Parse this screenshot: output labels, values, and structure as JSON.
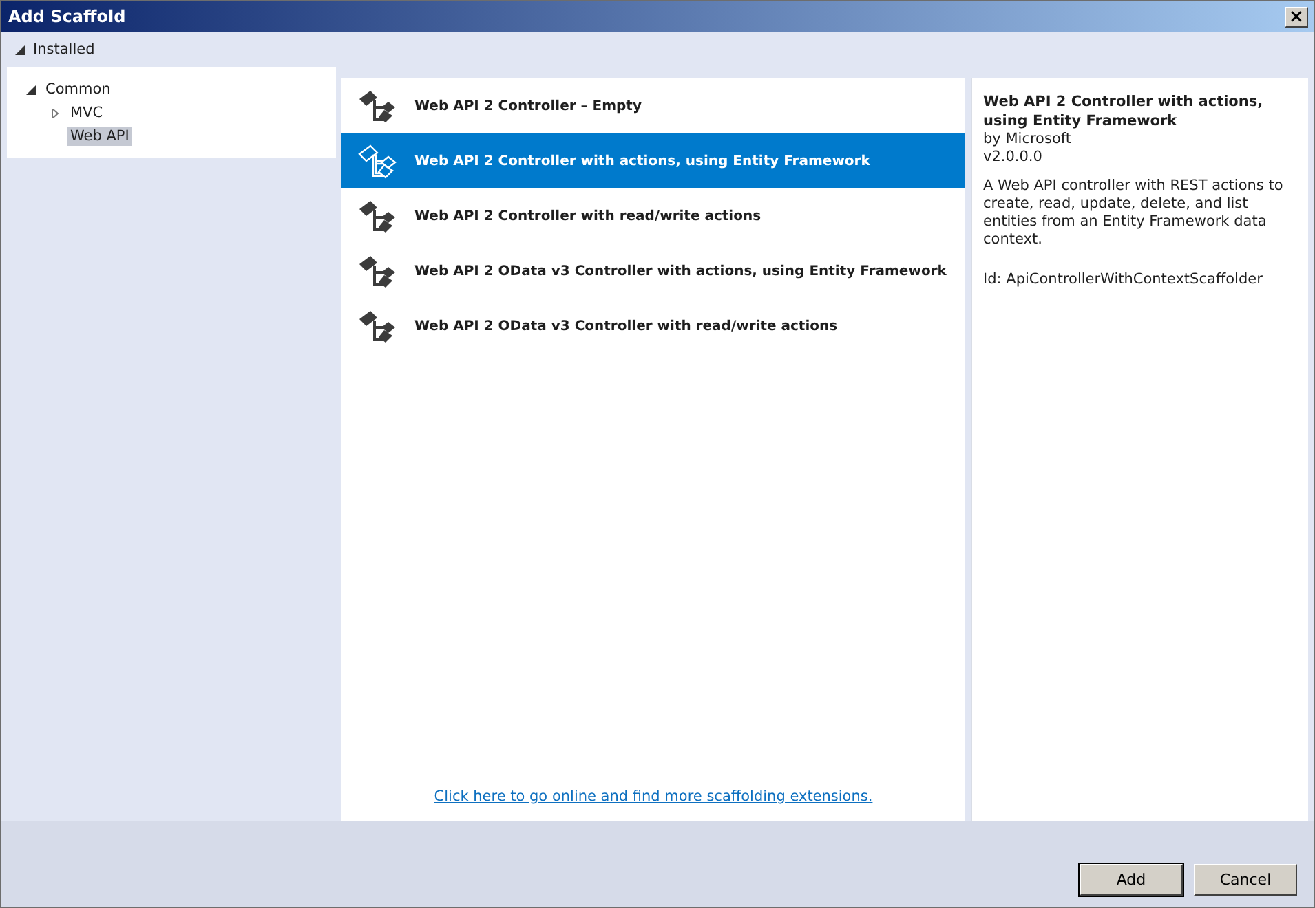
{
  "window": {
    "title": "Add Scaffold",
    "close": "×"
  },
  "installed": {
    "label": "Installed",
    "expanded": true
  },
  "tree": [
    {
      "label": "Common",
      "expanded": true,
      "selected": false,
      "children": [
        {
          "label": "MVC",
          "expanded": false,
          "selected": false
        },
        {
          "label": "Web API",
          "selected": true
        }
      ]
    }
  ],
  "templates": [
    {
      "label": "Web API 2 Controller – Empty",
      "selected": false
    },
    {
      "label": "Web API 2 Controller with actions, using Entity Framework",
      "selected": true
    },
    {
      "label": "Web API 2 Controller with read/write actions",
      "selected": false
    },
    {
      "label": "Web API 2 OData v3 Controller with actions, using Entity Framework",
      "selected": false
    },
    {
      "label": "Web API 2 OData v3 Controller with read/write actions",
      "selected": false
    }
  ],
  "online_link": "Click here to go online and find more scaffolding extensions.",
  "details": {
    "title": "Web API 2 Controller with actions, using Entity Framework",
    "author": "by Microsoft",
    "version": "v2.0.0.0",
    "description": "A Web API controller with REST actions to create, read, update, delete, and list entities from an Entity Framework data context.",
    "id": "Id: ApiControllerWithContextScaffolder"
  },
  "buttons": [
    {
      "label": "Add",
      "default": true
    },
    {
      "label": "Cancel",
      "default": false
    }
  ]
}
